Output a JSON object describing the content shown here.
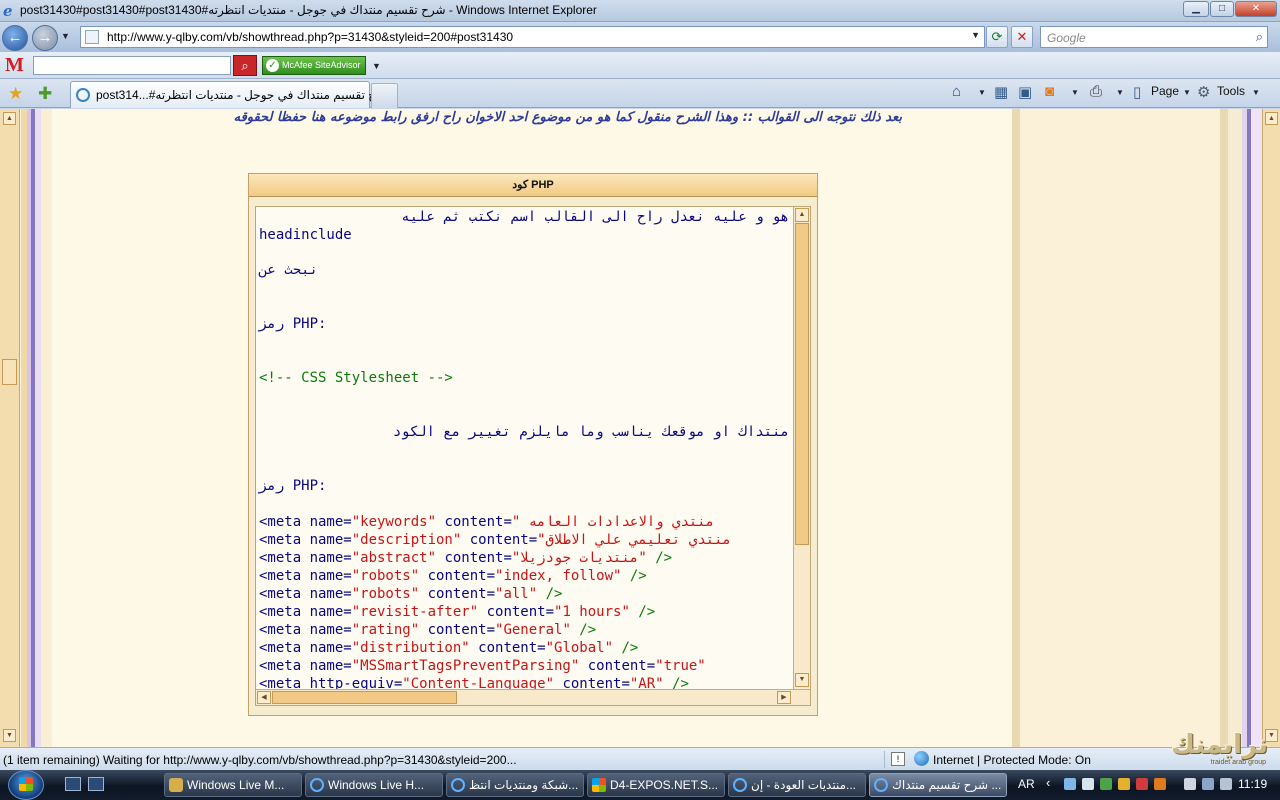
{
  "window": {
    "title": "post31430#post31430#post31430#شرح تقسيم منتداك في جوجل - منتديات انتظرته - Windows Internet Explorer",
    "minimize": "▁",
    "maximize": "□",
    "close": "✕"
  },
  "address_bar": {
    "url": "http://www.y-qlby.com/vb/showthread.php?p=31430&styleid=200#post31430",
    "search_placeholder": "Google"
  },
  "toolbar": {
    "mcafee_logo": "M",
    "siteadvisor_label": "McAfee SiteAdvisor"
  },
  "tabs": {
    "active_label": "post314...#شرح تقسيم منتداك في جوجل - منتديات انتظرته"
  },
  "command_bar": {
    "page_label": "Page",
    "tools_label": "Tools"
  },
  "content": {
    "headline": "بعد ذلك نتوجه الى القوالب :: وهذا الشرح منقول كما هو من موضوع احد الاخوان راح ارفق رابط موضوعه هنا حفظا لحقوقه",
    "code_block": {
      "header": "كود PHP",
      "lines": [
        {
          "text": "هو و عليه نعدل راح الى القالب اسم نكتب ثم عليه",
          "color": "navy",
          "rtl": true
        },
        {
          "text": "headinclude",
          "color": "navy",
          "rtl": false
        },
        {
          "text": "نبحث عن",
          "color": "navy",
          "rtl": false
        },
        {
          "text": "رمز PHP:",
          "color": "navy",
          "rtl": false
        },
        {
          "text": "<!-- CSS Stylesheet -->",
          "color": "green",
          "rtl": false
        },
        {
          "text": "منتداك او موقعك يناسب وما مايلزم تغيير مع الكود",
          "color": "navy",
          "rtl": true
        },
        {
          "text": "رمز PHP:",
          "color": "navy",
          "rtl": false
        },
        {
          "tag": "<meta name=",
          "attr": "\"keywords\"",
          "mid": " content=",
          "val": "\" منتدي والاعدادات العامه"
        },
        {
          "tag": "<meta name=",
          "attr": "\"description\"",
          "mid": " content=",
          "val": "\"منتدي تعليمي علي الاطلاق"
        },
        {
          "tag": "<meta name=",
          "attr": "\"abstract\"",
          "mid": " content=",
          "val": "\"منتديات جودزيلا\"",
          "end": " />"
        },
        {
          "tag": "<meta name=",
          "attr": "\"robots\"",
          "mid": " content=",
          "val": "\"index, follow\"",
          "end": " />"
        },
        {
          "tag": "<meta name=",
          "attr": "\"robots\"",
          "mid": " content=",
          "val": "\"all\"",
          "end": " />"
        },
        {
          "tag": "<meta name=",
          "attr": "\"revisit-after\"",
          "mid": " content=",
          "val": "\"1 hours\"",
          "end": " />"
        },
        {
          "tag": "<meta name=",
          "attr": "\"rating\"",
          "mid": " content=",
          "val": "\"General\"",
          "end": " />"
        },
        {
          "tag": "<meta name=",
          "attr": "\"distribution\"",
          "mid": " content=",
          "val": "\"Global\"",
          "end": " />"
        },
        {
          "tag": "<meta name=",
          "attr": "\"MSSmartTagsPreventParsing\"",
          "mid": " content=",
          "val": "\"true\"",
          "end": ""
        },
        {
          "tag": "<meta http-equiv=",
          "attr": "\"Content-Language\"",
          "mid": " content=",
          "val": "\"AR\"",
          "end": " />"
        }
      ]
    }
  },
  "status_bar": {
    "text": "(1 item remaining) Waiting for http://www.y-qlby.com/vb/showthread.php?p=31430&styleid=200...",
    "zone": "Internet | Protected Mode: On"
  },
  "logo": {
    "text": "نرايمنك",
    "subtext": "traidet arab group"
  },
  "taskbar": {
    "tasks": [
      "Windows Live M...",
      "Windows Live H...",
      "شبكة ومنتديات انتظ...",
      "D4-EXPOS.NET.S...",
      "منتديات العودة - إن...",
      "شرح تقسيم منتداك ..."
    ],
    "language": "AR",
    "clock": "11:19"
  },
  "colors": {
    "code_tag": "#08087c",
    "code_attr": "#c41616",
    "code_comment": "#0b7a0b",
    "page_bg": "#fef8e6",
    "accent_header": "#f2c982"
  }
}
